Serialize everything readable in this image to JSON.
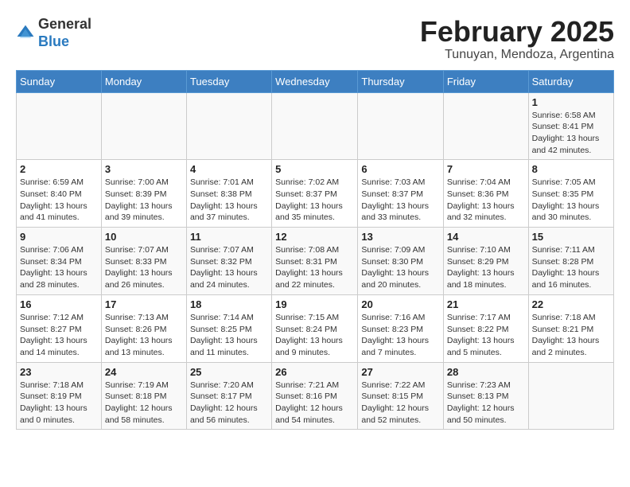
{
  "header": {
    "logo_line1": "General",
    "logo_line2": "Blue",
    "month_year": "February 2025",
    "location": "Tunuyan, Mendoza, Argentina"
  },
  "weekdays": [
    "Sunday",
    "Monday",
    "Tuesday",
    "Wednesday",
    "Thursday",
    "Friday",
    "Saturday"
  ],
  "weeks": [
    [
      {
        "day": "",
        "info": ""
      },
      {
        "day": "",
        "info": ""
      },
      {
        "day": "",
        "info": ""
      },
      {
        "day": "",
        "info": ""
      },
      {
        "day": "",
        "info": ""
      },
      {
        "day": "",
        "info": ""
      },
      {
        "day": "1",
        "info": "Sunrise: 6:58 AM\nSunset: 8:41 PM\nDaylight: 13 hours\nand 42 minutes."
      }
    ],
    [
      {
        "day": "2",
        "info": "Sunrise: 6:59 AM\nSunset: 8:40 PM\nDaylight: 13 hours\nand 41 minutes."
      },
      {
        "day": "3",
        "info": "Sunrise: 7:00 AM\nSunset: 8:39 PM\nDaylight: 13 hours\nand 39 minutes."
      },
      {
        "day": "4",
        "info": "Sunrise: 7:01 AM\nSunset: 8:38 PM\nDaylight: 13 hours\nand 37 minutes."
      },
      {
        "day": "5",
        "info": "Sunrise: 7:02 AM\nSunset: 8:37 PM\nDaylight: 13 hours\nand 35 minutes."
      },
      {
        "day": "6",
        "info": "Sunrise: 7:03 AM\nSunset: 8:37 PM\nDaylight: 13 hours\nand 33 minutes."
      },
      {
        "day": "7",
        "info": "Sunrise: 7:04 AM\nSunset: 8:36 PM\nDaylight: 13 hours\nand 32 minutes."
      },
      {
        "day": "8",
        "info": "Sunrise: 7:05 AM\nSunset: 8:35 PM\nDaylight: 13 hours\nand 30 minutes."
      }
    ],
    [
      {
        "day": "9",
        "info": "Sunrise: 7:06 AM\nSunset: 8:34 PM\nDaylight: 13 hours\nand 28 minutes."
      },
      {
        "day": "10",
        "info": "Sunrise: 7:07 AM\nSunset: 8:33 PM\nDaylight: 13 hours\nand 26 minutes."
      },
      {
        "day": "11",
        "info": "Sunrise: 7:07 AM\nSunset: 8:32 PM\nDaylight: 13 hours\nand 24 minutes."
      },
      {
        "day": "12",
        "info": "Sunrise: 7:08 AM\nSunset: 8:31 PM\nDaylight: 13 hours\nand 22 minutes."
      },
      {
        "day": "13",
        "info": "Sunrise: 7:09 AM\nSunset: 8:30 PM\nDaylight: 13 hours\nand 20 minutes."
      },
      {
        "day": "14",
        "info": "Sunrise: 7:10 AM\nSunset: 8:29 PM\nDaylight: 13 hours\nand 18 minutes."
      },
      {
        "day": "15",
        "info": "Sunrise: 7:11 AM\nSunset: 8:28 PM\nDaylight: 13 hours\nand 16 minutes."
      }
    ],
    [
      {
        "day": "16",
        "info": "Sunrise: 7:12 AM\nSunset: 8:27 PM\nDaylight: 13 hours\nand 14 minutes."
      },
      {
        "day": "17",
        "info": "Sunrise: 7:13 AM\nSunset: 8:26 PM\nDaylight: 13 hours\nand 13 minutes."
      },
      {
        "day": "18",
        "info": "Sunrise: 7:14 AM\nSunset: 8:25 PM\nDaylight: 13 hours\nand 11 minutes."
      },
      {
        "day": "19",
        "info": "Sunrise: 7:15 AM\nSunset: 8:24 PM\nDaylight: 13 hours\nand 9 minutes."
      },
      {
        "day": "20",
        "info": "Sunrise: 7:16 AM\nSunset: 8:23 PM\nDaylight: 13 hours\nand 7 minutes."
      },
      {
        "day": "21",
        "info": "Sunrise: 7:17 AM\nSunset: 8:22 PM\nDaylight: 13 hours\nand 5 minutes."
      },
      {
        "day": "22",
        "info": "Sunrise: 7:18 AM\nSunset: 8:21 PM\nDaylight: 13 hours\nand 2 minutes."
      }
    ],
    [
      {
        "day": "23",
        "info": "Sunrise: 7:18 AM\nSunset: 8:19 PM\nDaylight: 13 hours\nand 0 minutes."
      },
      {
        "day": "24",
        "info": "Sunrise: 7:19 AM\nSunset: 8:18 PM\nDaylight: 12 hours\nand 58 minutes."
      },
      {
        "day": "25",
        "info": "Sunrise: 7:20 AM\nSunset: 8:17 PM\nDaylight: 12 hours\nand 56 minutes."
      },
      {
        "day": "26",
        "info": "Sunrise: 7:21 AM\nSunset: 8:16 PM\nDaylight: 12 hours\nand 54 minutes."
      },
      {
        "day": "27",
        "info": "Sunrise: 7:22 AM\nSunset: 8:15 PM\nDaylight: 12 hours\nand 52 minutes."
      },
      {
        "day": "28",
        "info": "Sunrise: 7:23 AM\nSunset: 8:13 PM\nDaylight: 12 hours\nand 50 minutes."
      },
      {
        "day": "",
        "info": ""
      }
    ]
  ]
}
